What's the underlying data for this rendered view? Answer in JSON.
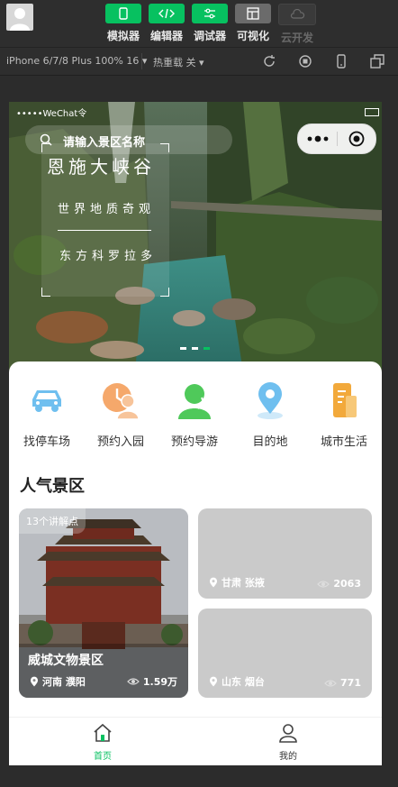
{
  "toolbar": {
    "tools": [
      {
        "label": "模拟器",
        "icon": "phone-icon"
      },
      {
        "label": "编辑器",
        "icon": "code-icon"
      },
      {
        "label": "调试器",
        "icon": "debug-icon"
      },
      {
        "label": "可视化",
        "icon": "layout-icon"
      },
      {
        "label": "云开发",
        "icon": "cloud-icon"
      }
    ]
  },
  "devicebar": {
    "device": "iPhone 6/7/8 Plus 100% 16 ▾",
    "hotreload": "热重载 关 ▾"
  },
  "status": {
    "carrier": "•••••WeChat令",
    "battery": "100%"
  },
  "banner": {
    "search_placeholder": "请输入景区名称",
    "poster_title": "恩施大峡谷",
    "poster_line1": "世界地质奇观",
    "poster_line2": "东方科罗拉多"
  },
  "nav": [
    {
      "label": "找停车场",
      "icon": "car-icon",
      "color": "#6fbfef"
    },
    {
      "label": "预约入园",
      "icon": "clock-person-icon",
      "color": "#f5a86b"
    },
    {
      "label": "预约导游",
      "icon": "guide-icon",
      "color": "#4fc95a"
    },
    {
      "label": "目的地",
      "icon": "location-pin-icon",
      "color": "#6fbfef"
    },
    {
      "label": "城市生活",
      "icon": "document-icon",
      "color": "#f2a93b"
    }
  ],
  "section": {
    "title": "人气景区"
  },
  "scenic": [
    {
      "tag": "13个讲解点",
      "name": "威城文物景区",
      "location": "河南 濮阳",
      "views": "1.59万"
    },
    {
      "tag": "",
      "name": "",
      "location": "甘肃 张掖",
      "views": "2063"
    },
    {
      "tag": "",
      "name": "",
      "location": "山东 烟台",
      "views": "771"
    }
  ],
  "tabbar": [
    {
      "label": "首页",
      "icon": "home-icon",
      "active": true
    },
    {
      "label": "我的",
      "icon": "user-icon",
      "active": false
    }
  ],
  "colors": {
    "accent": "#07c160",
    "placeholder_card": "#cacaca"
  }
}
